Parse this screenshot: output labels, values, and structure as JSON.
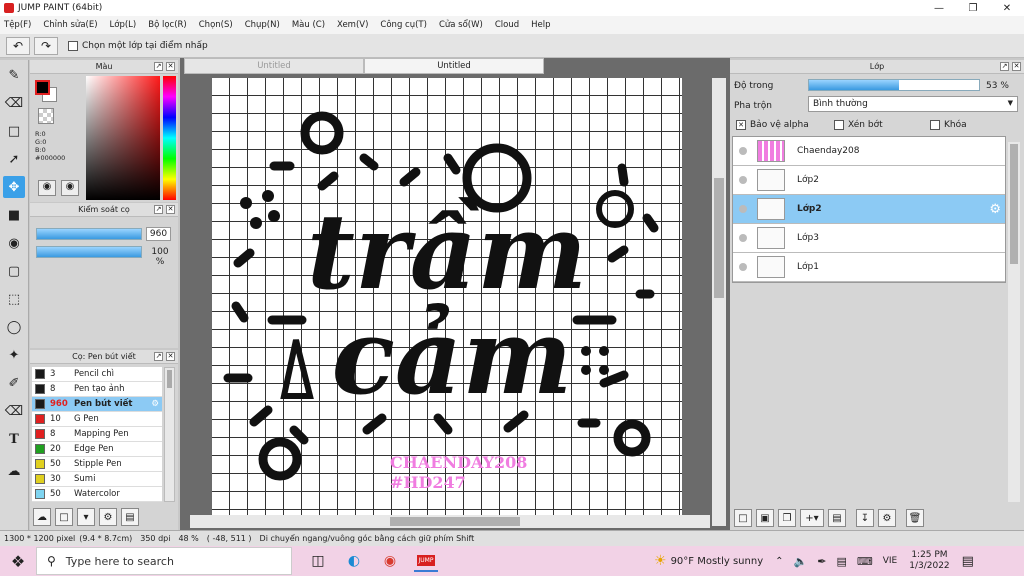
{
  "window": {
    "title": "JUMP PAINT (64bit)",
    "min": "—",
    "max": "❐",
    "close": "✕"
  },
  "menu": [
    "Tệp(F)",
    "Chỉnh sửa(E)",
    "Lớp(L)",
    "Bộ lọc(R)",
    "Chọn(S)",
    "Chụp(N)",
    "Màu (C)",
    "Xem(V)",
    "Công cụ(T)",
    "Cửa sổ(W)",
    "Cloud",
    "Help"
  ],
  "toolbar": {
    "undo_icon": "undo-icon",
    "redo_icon": "redo-icon",
    "select_layer_label": "Chọn một lớp tại điểm nhấp"
  },
  "color_panel": {
    "title": "Màu",
    "r": "R:0",
    "g": "G:0",
    "b": "B:0",
    "hex": "#000000",
    "fg": "#000000",
    "bg": "#ffffff"
  },
  "brush_control": {
    "title": "Kiểm soát cọ",
    "size": "960",
    "opacity": "100 %",
    "size_level": 1.0,
    "opacity_level": 1.0
  },
  "brush_list": {
    "title": "Cọ: Pen bút viết",
    "items": [
      {
        "color": "#1a1a1a",
        "size": "3",
        "name": "Pencil chì",
        "selected": false
      },
      {
        "color": "#1a1a1a",
        "size": "8",
        "name": "Pen tạo ảnh",
        "selected": false
      },
      {
        "color": "#1a1a1a",
        "size": "960",
        "name": "Pen bút viết",
        "selected": true
      },
      {
        "color": "#e02020",
        "size": "10",
        "name": "G Pen",
        "selected": false
      },
      {
        "color": "#e02020",
        "size": "8",
        "name": "Mapping Pen",
        "selected": false
      },
      {
        "color": "#20a020",
        "size": "20",
        "name": "Edge Pen",
        "selected": false
      },
      {
        "color": "#e0d020",
        "size": "50",
        "name": "Stipple Pen",
        "selected": false
      },
      {
        "color": "#e0d020",
        "size": "30",
        "name": "Sumi",
        "selected": false
      },
      {
        "color": "#7fd4f0",
        "size": "50",
        "name": "Watercolor",
        "selected": false
      }
    ]
  },
  "canvas": {
    "tabs": [
      "Untitled",
      "Untitled"
    ],
    "line1": "trầm",
    "line2": "cảm",
    "watermark1": "CHAENDAY208",
    "watermark2": "#HD247",
    "watermark_color": "#f07de0"
  },
  "layers_panel": {
    "title": "Lớp",
    "opacity_label": "Độ trong",
    "opacity_value": "53 %",
    "opacity_level": 0.53,
    "blend_label": "Pha trộn",
    "blend_value": "Bình thường",
    "protect_alpha": "Bảo vệ alpha",
    "clip": "Xén bớt",
    "lock": "Khóa",
    "layers": [
      {
        "name": "Chaenday208",
        "selected": false
      },
      {
        "name": "Lớp2",
        "selected": false
      },
      {
        "name": "Lớp2",
        "selected": true
      },
      {
        "name": "Lớp3",
        "selected": false
      },
      {
        "name": "Lớp1",
        "selected": false
      }
    ]
  },
  "status": {
    "size": "1300 * 1200 pixel",
    "cm": "(9.4 * 8.7cm)",
    "dpi": "350 dpi",
    "zoom": "48 %",
    "coords": "( -48, 511 )",
    "hint": "Di chuyển ngang/vuông góc bằng cách giữ phím Shift"
  },
  "taskbar": {
    "search_placeholder": "Type here to search",
    "weather": "90°F  Mostly sunny",
    "lang": "VIE",
    "time": "1:25 PM",
    "date": "1/3/2022"
  }
}
